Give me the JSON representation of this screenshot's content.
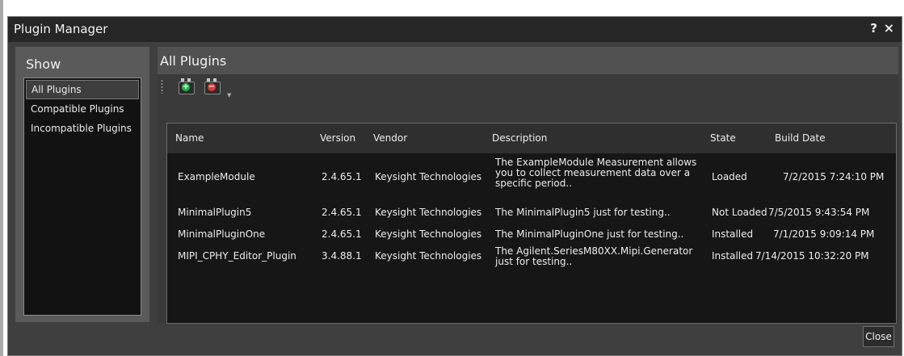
{
  "window": {
    "title": "Plugin Manager",
    "help_label": "?",
    "close_label": "×"
  },
  "show": {
    "title": "Show",
    "items": [
      "All Plugins",
      "Compatible Plugins",
      "Incompatible Plugins"
    ],
    "selected": "All Plugins"
  },
  "main": {
    "title": "All Plugins",
    "toolbar": {
      "add_icon": "add-plugin-icon",
      "remove_icon": "remove-plugin-icon",
      "add_color": "#1fb34a",
      "remove_color": "#d63a3a"
    },
    "columns": [
      "Name",
      "Version",
      "Vendor",
      "Description",
      "State",
      "Build Date"
    ],
    "rows": [
      {
        "name": "ExampleModule",
        "version": "2.4.65.1",
        "vendor": "Keysight Technologies",
        "description": "The ExampleModule Measurement allows you to collect measurement data over a specific period..",
        "state": "Loaded",
        "build_date": "7/2/2015 7:24:10 PM"
      },
      {
        "name": "MinimalPlugin5",
        "version": "2.4.65.1",
        "vendor": "Keysight Technologies",
        "description": "The MinimalPlugin5 just for testing..",
        "state": "Not Loaded",
        "build_date": "7/5/2015 9:43:54 PM"
      },
      {
        "name": "MinimalPluginOne",
        "version": "2.4.65.1",
        "vendor": "Keysight Technologies",
        "description": "The MinimalPluginOne just for testing..",
        "state": "Installed",
        "build_date": "7/1/2015 9:09:14 PM"
      },
      {
        "name": "MIPI_CPHY_Editor_Plugin",
        "version": "3.4.88.1",
        "vendor": "Keysight Technologies",
        "description": "The Agilent.SeriesM80XX.Mipi.Generator just for testing..",
        "state": "Installed",
        "build_date": "7/14/2015 10:32:20 PM"
      }
    ]
  },
  "footer": {
    "close_label": "Close"
  }
}
